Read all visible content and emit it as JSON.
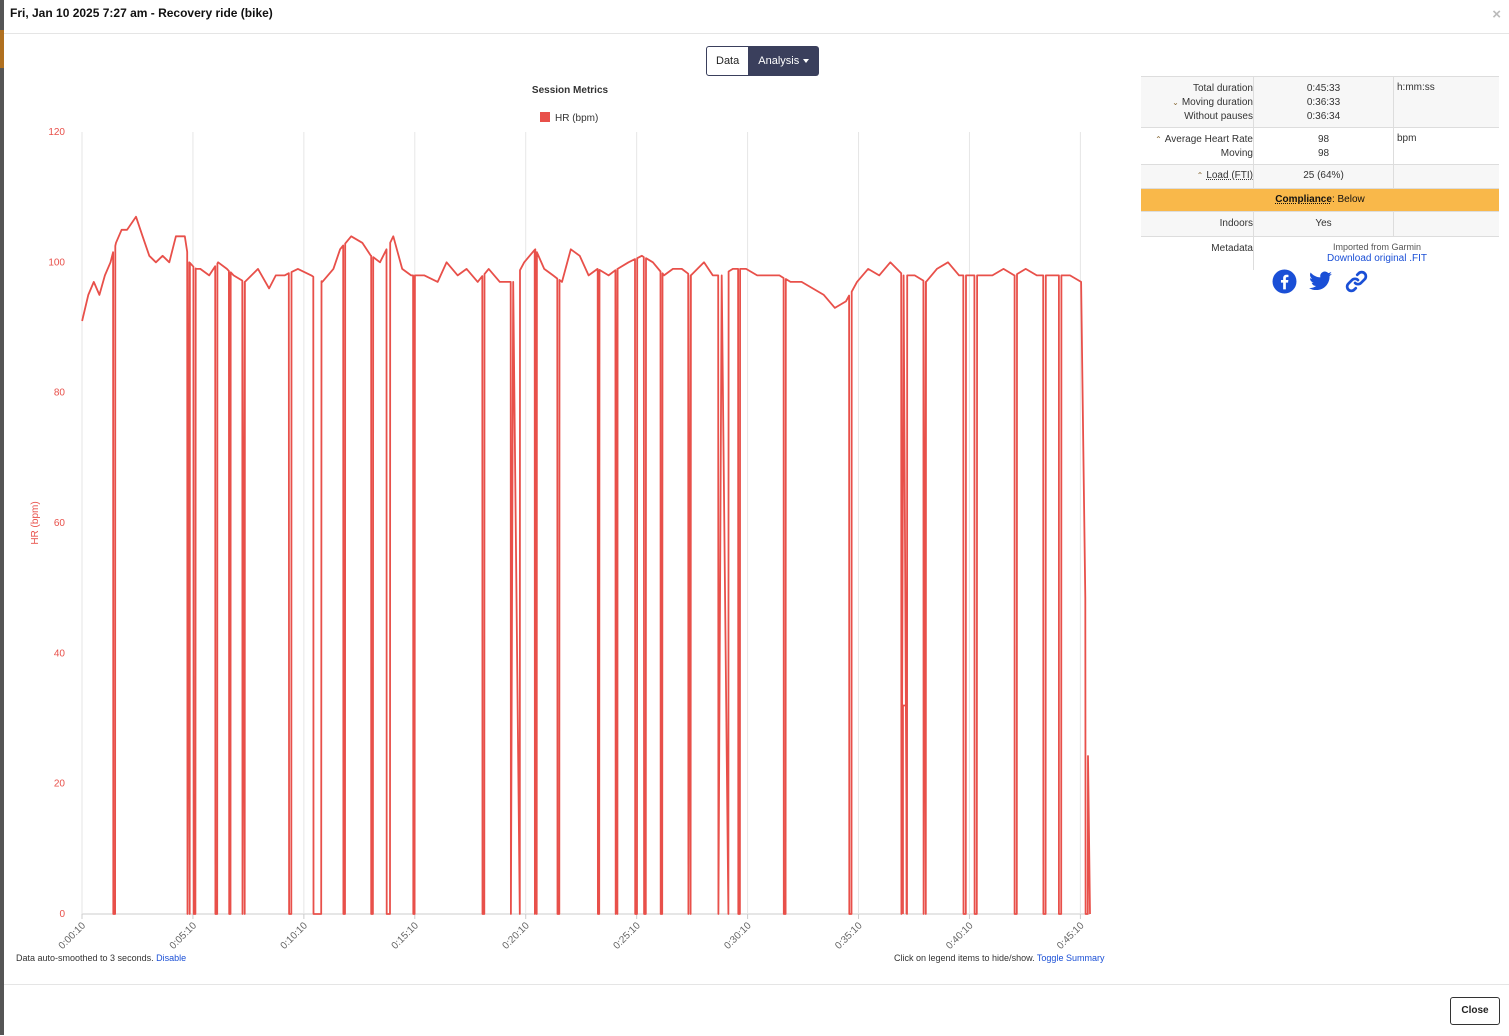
{
  "window": {
    "title": "Fri, Jan 10 2025 7:27 am - Recovery ride (bike)",
    "close_glyph": "×"
  },
  "tabs": {
    "data": "Data",
    "analysis": "Analysis"
  },
  "footnote": {
    "smooth_text": "Data auto-smoothed to 3 seconds.",
    "disable": "Disable",
    "legend_hint": "Click on legend items to hide/show.",
    "toggle": "Toggle Summary"
  },
  "summary": {
    "total_duration_label": "Total duration",
    "total_duration": "0:45:33",
    "moving_duration_label": "Moving duration",
    "moving_duration": "0:36:33",
    "without_pauses_label": "Without pauses",
    "without_pauses": "0:36:34",
    "duration_unit": "h:mm:ss",
    "avg_hr_label": "Average Heart Rate",
    "avg_hr": "98",
    "hr_unit": "bpm",
    "moving_label": "Moving",
    "moving_hr": "98",
    "load_label": "Load (FTI)",
    "load_value": "25 (64%)",
    "compliance_label": "Compliance",
    "compliance_value": ": Below",
    "indoors_label": "Indoors",
    "indoors_value": "Yes",
    "metadata_label": "Metadata",
    "imported_from": "Imported from Garmin",
    "download_link": "Download original .FIT"
  },
  "social": {
    "icons": [
      "facebook-icon",
      "twitter-icon",
      "link-icon"
    ],
    "color": "#1a4fd6"
  },
  "footer": {
    "close": "Close"
  },
  "chart_data": {
    "type": "line",
    "title": "Session Metrics",
    "ylabel": "HR (bpm)",
    "xlabel": "",
    "ylim": [
      0,
      120
    ],
    "yticks": [
      0,
      20,
      40,
      60,
      80,
      100,
      120
    ],
    "xticks": [
      "0:00:10",
      "0:05:10",
      "0:10:10",
      "0:15:10",
      "0:20:10",
      "0:25:10",
      "0:30:10",
      "0:35:10",
      "0:40:10",
      "0:45:10"
    ],
    "x_unit": "minutes",
    "xlim": [
      0.167,
      45.6
    ],
    "legend_position": "top-center",
    "series": [
      {
        "name": "HR (bpm)",
        "color": "#e8504a",
        "points": [
          [
            0.17,
            91
          ],
          [
            0.45,
            95
          ],
          [
            0.7,
            97
          ],
          [
            0.95,
            95
          ],
          [
            1.2,
            98
          ],
          [
            1.45,
            100
          ],
          [
            1.7,
            103
          ],
          [
            1.95,
            105
          ],
          [
            2.2,
            105
          ],
          [
            2.6,
            107
          ],
          [
            2.9,
            104
          ],
          [
            3.2,
            101
          ],
          [
            3.5,
            100
          ],
          [
            3.8,
            101
          ],
          [
            4.1,
            100
          ],
          [
            4.4,
            104
          ],
          [
            4.8,
            104
          ],
          [
            5.0,
            100
          ],
          [
            5.3,
            99
          ],
          [
            5.5,
            99
          ],
          [
            5.9,
            98
          ],
          [
            6.3,
            100
          ],
          [
            6.7,
            99
          ],
          [
            7.0,
            98
          ],
          [
            7.5,
            97
          ],
          [
            8.1,
            99
          ],
          [
            8.6,
            96
          ],
          [
            8.9,
            98
          ],
          [
            9.3,
            98
          ],
          [
            9.9,
            99
          ],
          [
            10.5,
            98
          ],
          [
            11,
            97
          ],
          [
            11.5,
            99
          ],
          [
            11.8,
            102
          ],
          [
            12.3,
            104
          ],
          [
            12.8,
            103
          ],
          [
            13.2,
            101
          ],
          [
            13.6,
            100
          ],
          [
            14.2,
            104
          ],
          [
            14.6,
            99
          ],
          [
            15.0,
            98
          ],
          [
            15.6,
            98
          ],
          [
            16.2,
            97
          ],
          [
            16.6,
            100
          ],
          [
            17.1,
            98
          ],
          [
            17.5,
            99
          ],
          [
            18.0,
            97
          ],
          [
            18.5,
            99
          ],
          [
            19.0,
            97
          ],
          [
            19.6,
            97
          ],
          [
            20.1,
            100
          ],
          [
            20.6,
            102
          ],
          [
            21.0,
            99
          ],
          [
            21.4,
            98
          ],
          [
            21.8,
            97
          ],
          [
            22.2,
            102
          ],
          [
            22.6,
            101
          ],
          [
            23.0,
            98
          ],
          [
            23.4,
            99
          ],
          [
            23.9,
            98
          ],
          [
            24.3,
            99
          ],
          [
            24.8,
            100
          ],
          [
            25.4,
            101
          ],
          [
            25.9,
            100
          ],
          [
            26.4,
            98
          ],
          [
            26.8,
            99
          ],
          [
            27.2,
            99
          ],
          [
            27.6,
            98
          ],
          [
            28.2,
            100
          ],
          [
            28.6,
            98
          ],
          [
            29.0,
            98
          ],
          [
            29.5,
            99
          ],
          [
            30.1,
            99
          ],
          [
            30.6,
            98
          ],
          [
            31.1,
            98
          ],
          [
            31.6,
            98
          ],
          [
            32.1,
            97
          ],
          [
            32.6,
            97
          ],
          [
            33.1,
            96
          ],
          [
            33.6,
            95
          ],
          [
            34.1,
            93
          ],
          [
            34.6,
            94
          ],
          [
            35.1,
            97
          ],
          [
            35.6,
            99
          ],
          [
            36.1,
            98
          ],
          [
            36.6,
            100
          ],
          [
            37.2,
            98
          ],
          [
            37.7,
            98
          ],
          [
            38.2,
            97
          ],
          [
            38.7,
            99
          ],
          [
            39.2,
            100
          ],
          [
            39.7,
            98
          ],
          [
            40.2,
            98
          ],
          [
            40.7,
            98
          ],
          [
            41.2,
            98
          ],
          [
            41.7,
            99
          ],
          [
            42.2,
            98
          ],
          [
            42.7,
            99
          ],
          [
            43.2,
            98
          ],
          [
            43.7,
            98
          ],
          [
            44.2,
            98
          ],
          [
            44.7,
            98
          ],
          [
            45.2,
            97
          ],
          [
            45.6,
            0
          ]
        ],
        "dropouts": [
          [
            1.58,
            1.66
          ],
          [
            4.92,
            5.02
          ],
          [
            5.2,
            5.28
          ],
          [
            6.18,
            6.26
          ],
          [
            6.8,
            6.86
          ],
          [
            7.4,
            7.5
          ],
          [
            9.5,
            9.6
          ],
          [
            10.6,
            10.95
          ],
          [
            11.95,
            12.02
          ],
          [
            13.2,
            13.28
          ],
          [
            13.9,
            14.05
          ],
          [
            15.1,
            15.16
          ],
          [
            18.22,
            18.3
          ],
          [
            19.5,
            19.9
          ],
          [
            20.58,
            20.66
          ],
          [
            21.6,
            21.68
          ],
          [
            23.42,
            23.48
          ],
          [
            24.22,
            24.3
          ],
          [
            25.1,
            25.18
          ],
          [
            25.5,
            25.58
          ],
          [
            26.25,
            26.32
          ],
          [
            27.5,
            27.6
          ],
          [
            28.85,
            29.3
          ],
          [
            29.75,
            29.82
          ],
          [
            31.8,
            31.88
          ],
          [
            34.75,
            34.85
          ],
          [
            37.1,
            37.35
          ],
          [
            38.1,
            38.2
          ],
          [
            39.9,
            40.0
          ],
          [
            40.4,
            40.5
          ],
          [
            42.2,
            42.3
          ],
          [
            43.5,
            43.6
          ],
          [
            44.2,
            44.3
          ],
          [
            45.4,
            45.5
          ]
        ]
      }
    ],
    "annotation_point": {
      "x": 37.25,
      "y": 32
    }
  }
}
